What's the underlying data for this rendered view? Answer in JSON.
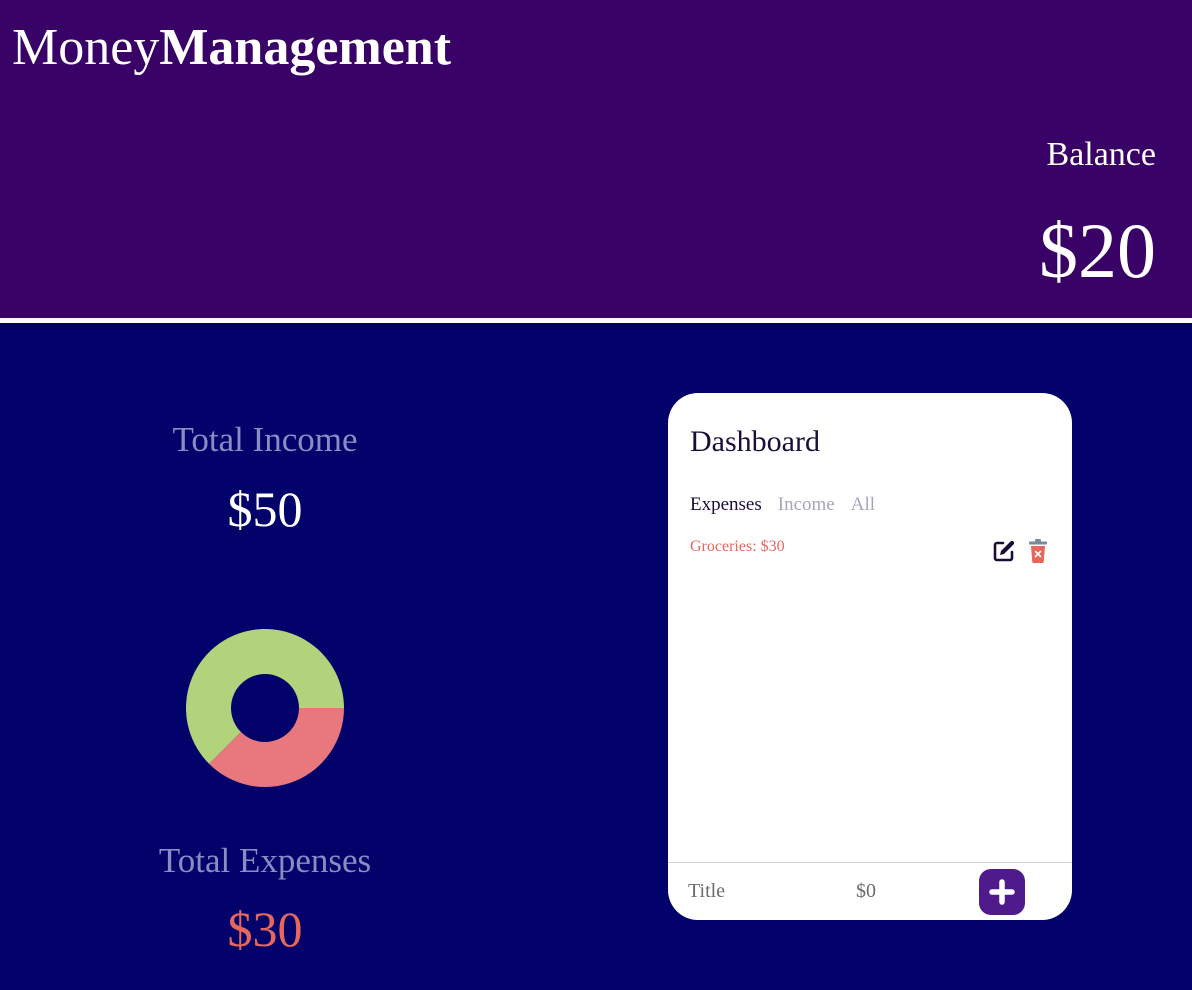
{
  "app": {
    "title_regular": "Money",
    "title_bold": "Management"
  },
  "balance": {
    "label": "Balance",
    "amount": "$20"
  },
  "summary": {
    "income_label": "Total Income",
    "income_amount": "$50",
    "expense_label": "Total Expenses",
    "expense_amount": "$30"
  },
  "chart_data": {
    "type": "pie",
    "categories": [
      "Income",
      "Expenses"
    ],
    "values": [
      50,
      30
    ],
    "colors": [
      "#b2d37c",
      "#e8777e"
    ],
    "title": ""
  },
  "dashboard": {
    "title": "Dashboard",
    "tabs": [
      {
        "label": "Expenses",
        "active": true
      },
      {
        "label": "Income",
        "active": false
      },
      {
        "label": "All",
        "active": false
      }
    ],
    "entries": [
      {
        "text": "Groceries: $30",
        "color": "#e8675c"
      }
    ],
    "form": {
      "title_placeholder": "Title",
      "amount_placeholder": "$0"
    }
  },
  "colors": {
    "header_bg": "#380266",
    "page_bg": "#02026a",
    "expense": "#e8675c",
    "income_slice": "#b2d37c",
    "expense_slice": "#e8777e",
    "accent": "#4f1a8c"
  }
}
